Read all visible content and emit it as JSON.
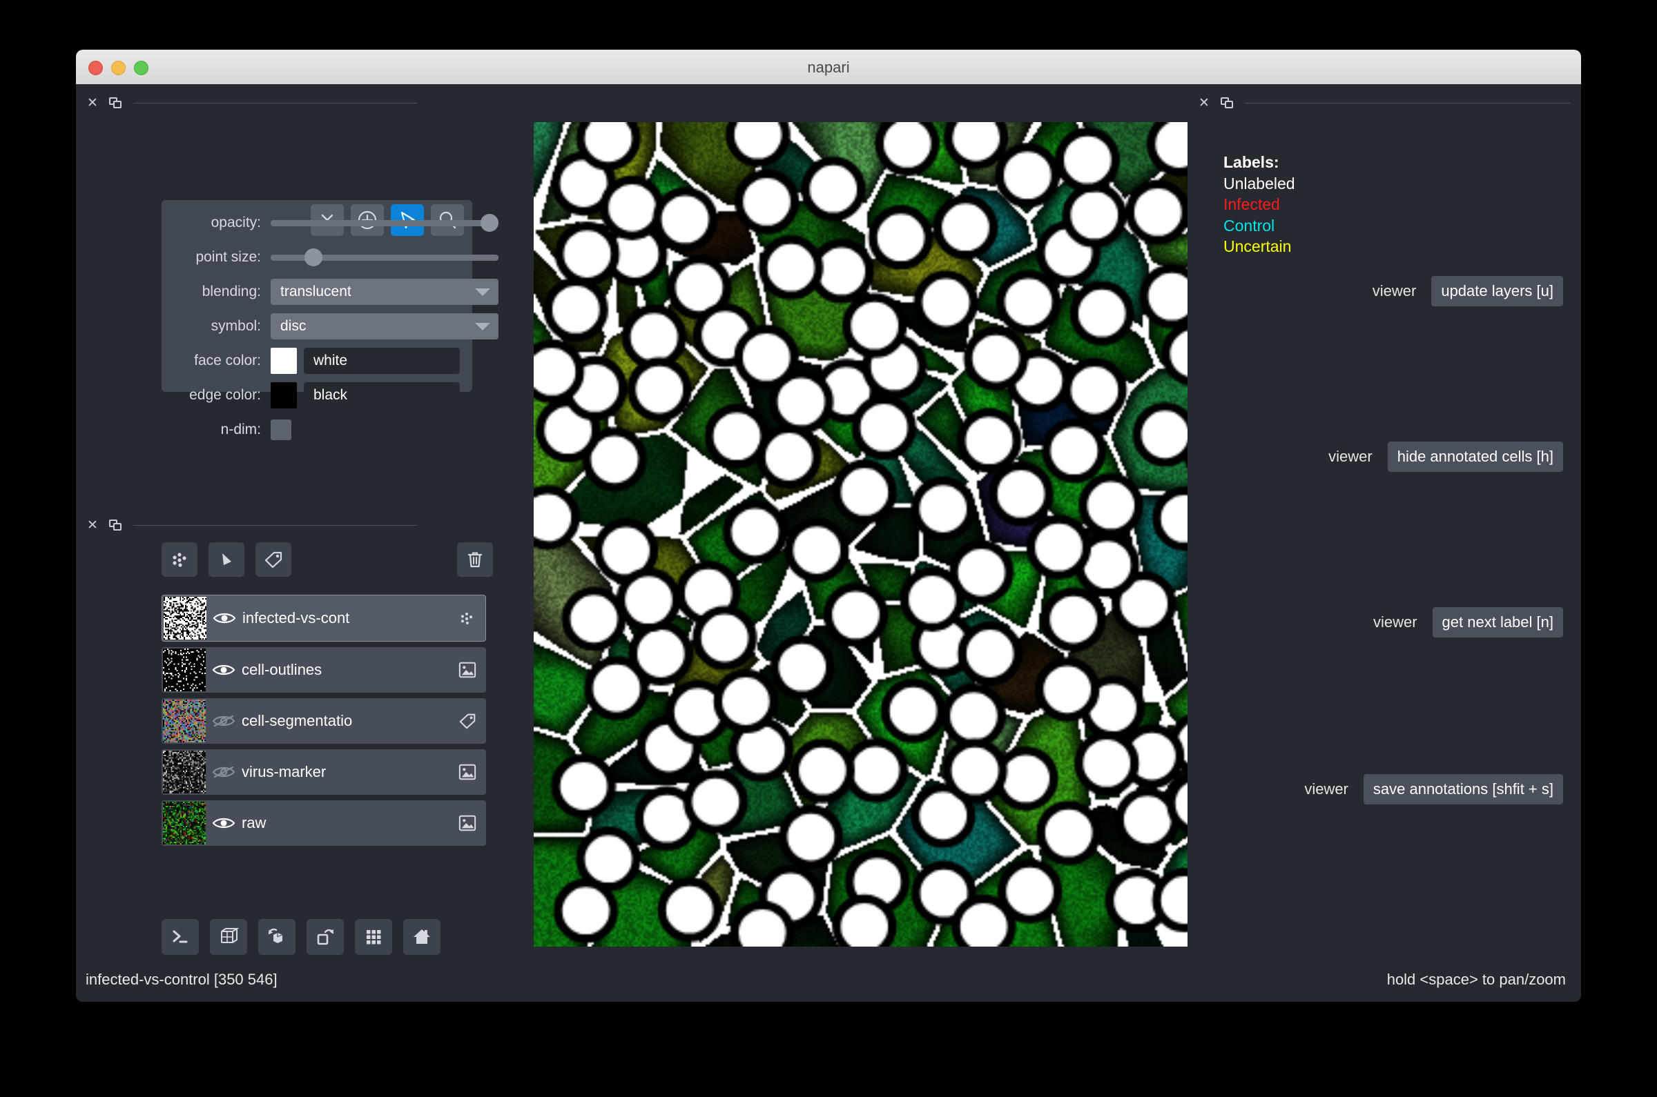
{
  "window": {
    "title": "napari",
    "traffic_lights": [
      "close",
      "minimize",
      "zoom"
    ]
  },
  "points_controls": {
    "modes": [
      {
        "name": "delete-selected-points",
        "icon": "x-icon",
        "active": false
      },
      {
        "name": "add-points",
        "icon": "plus-circle-icon",
        "active": false
      },
      {
        "name": "select-points",
        "icon": "cursor-arrow-icon",
        "active": true
      },
      {
        "name": "pan-zoom",
        "icon": "magnifier-icon",
        "active": false
      }
    ],
    "rows": [
      {
        "label": "opacity:",
        "type": "slider",
        "value": 100
      },
      {
        "label": "point size:",
        "type": "slider",
        "value": 16
      },
      {
        "label": "blending:",
        "type": "combo",
        "value": "translucent"
      },
      {
        "label": "symbol:",
        "type": "combo",
        "value": "disc"
      },
      {
        "label": "face color:",
        "type": "color",
        "value": "white",
        "swatch": "#ffffff"
      },
      {
        "label": "edge color:",
        "type": "color",
        "value": "black",
        "swatch": "#000000"
      },
      {
        "label": "n-dim:",
        "type": "checkbox",
        "checked": false
      }
    ]
  },
  "layer_toolbar": {
    "buttons": [
      {
        "name": "new-points-layer",
        "icon": "points-icon"
      },
      {
        "name": "new-shapes-layer",
        "icon": "shapes-icon"
      },
      {
        "name": "new-labels-layer",
        "icon": "labels-tag-icon"
      }
    ],
    "delete": {
      "name": "delete-layer",
      "icon": "trash-icon"
    }
  },
  "layers": [
    {
      "name": "infected-vs-cont",
      "visible": true,
      "selected": true,
      "type_icon": "points-icon",
      "thumb": "bw-dense"
    },
    {
      "name": "cell-outlines",
      "visible": true,
      "selected": false,
      "type_icon": "image-icon",
      "thumb": "bw-sparse"
    },
    {
      "name": "cell-segmentatio",
      "visible": false,
      "selected": false,
      "type_icon": "labels-tag-icon",
      "thumb": "color-noise"
    },
    {
      "name": "virus-marker",
      "visible": false,
      "selected": false,
      "type_icon": "image-icon",
      "thumb": "gray-noise"
    },
    {
      "name": "raw",
      "visible": true,
      "selected": false,
      "type_icon": "image-icon",
      "thumb": "green-noise"
    }
  ],
  "viewer_buttons": [
    {
      "name": "console-button",
      "icon": "terminal-icon"
    },
    {
      "name": "ndisplay-button",
      "icon": "cube-wireframe-icon"
    },
    {
      "name": "roll-dims-button",
      "icon": "cube-rotate-icon"
    },
    {
      "name": "transpose-dims-button",
      "icon": "square-rotate-icon"
    },
    {
      "name": "grid-view-button",
      "icon": "grid-icon"
    },
    {
      "name": "home-button",
      "icon": "home-icon"
    }
  ],
  "right_panel": {
    "labels_heading": "Labels:",
    "labels": [
      {
        "text": "Unlabeled",
        "color": "#ffffff"
      },
      {
        "text": "Infected",
        "color": "#ff1a1a"
      },
      {
        "text": "Control",
        "color": "#00e5e5"
      },
      {
        "text": "Uncertain",
        "color": "#ffff00"
      }
    ],
    "actions": [
      {
        "label": "viewer",
        "button": "update layers [u]"
      },
      {
        "label": "viewer",
        "button": "hide annotated cells [h]"
      },
      {
        "label": "viewer",
        "button": "get next label [n]"
      },
      {
        "label": "viewer",
        "button": "save annotations [shfit + s]"
      }
    ]
  },
  "status_bar": {
    "left": "infected-vs-control [350 546]",
    "right": "hold <space> to pan/zoom"
  },
  "colors": {
    "window_bg": "#262930",
    "panel_bg": "#414851",
    "accent": "#0a84d8",
    "layer_row": "#474e59",
    "layer_row_selected": "#535b66"
  }
}
